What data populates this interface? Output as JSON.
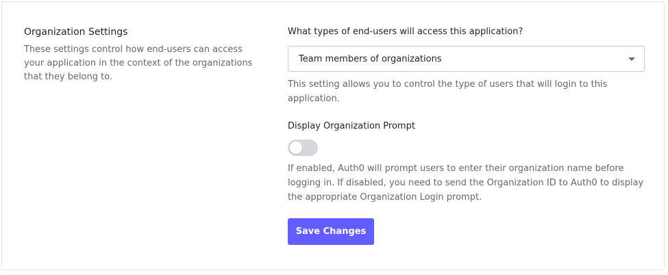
{
  "section": {
    "title": "Organization Settings",
    "description": "These settings control how end-users can access your application in the context of the organizations that they belong to."
  },
  "user_types": {
    "label": "What types of end-users will access this application?",
    "selected": "Team members of organizations",
    "help": "This setting allows you to control the type of users that will login to this application."
  },
  "org_prompt": {
    "label": "Display Organization Prompt",
    "enabled": false,
    "help": "If enabled, Auth0 will prompt users to enter their organization name before logging in. If disabled, you need to send the Organization ID to Auth0 to display the appropriate Organization Login prompt."
  },
  "actions": {
    "save_label": "Save Changes"
  },
  "colors": {
    "accent": "#635dff",
    "toggle_off": "#d7d8dc"
  },
  "icons": {
    "select_caret": "chevron-down-icon"
  }
}
